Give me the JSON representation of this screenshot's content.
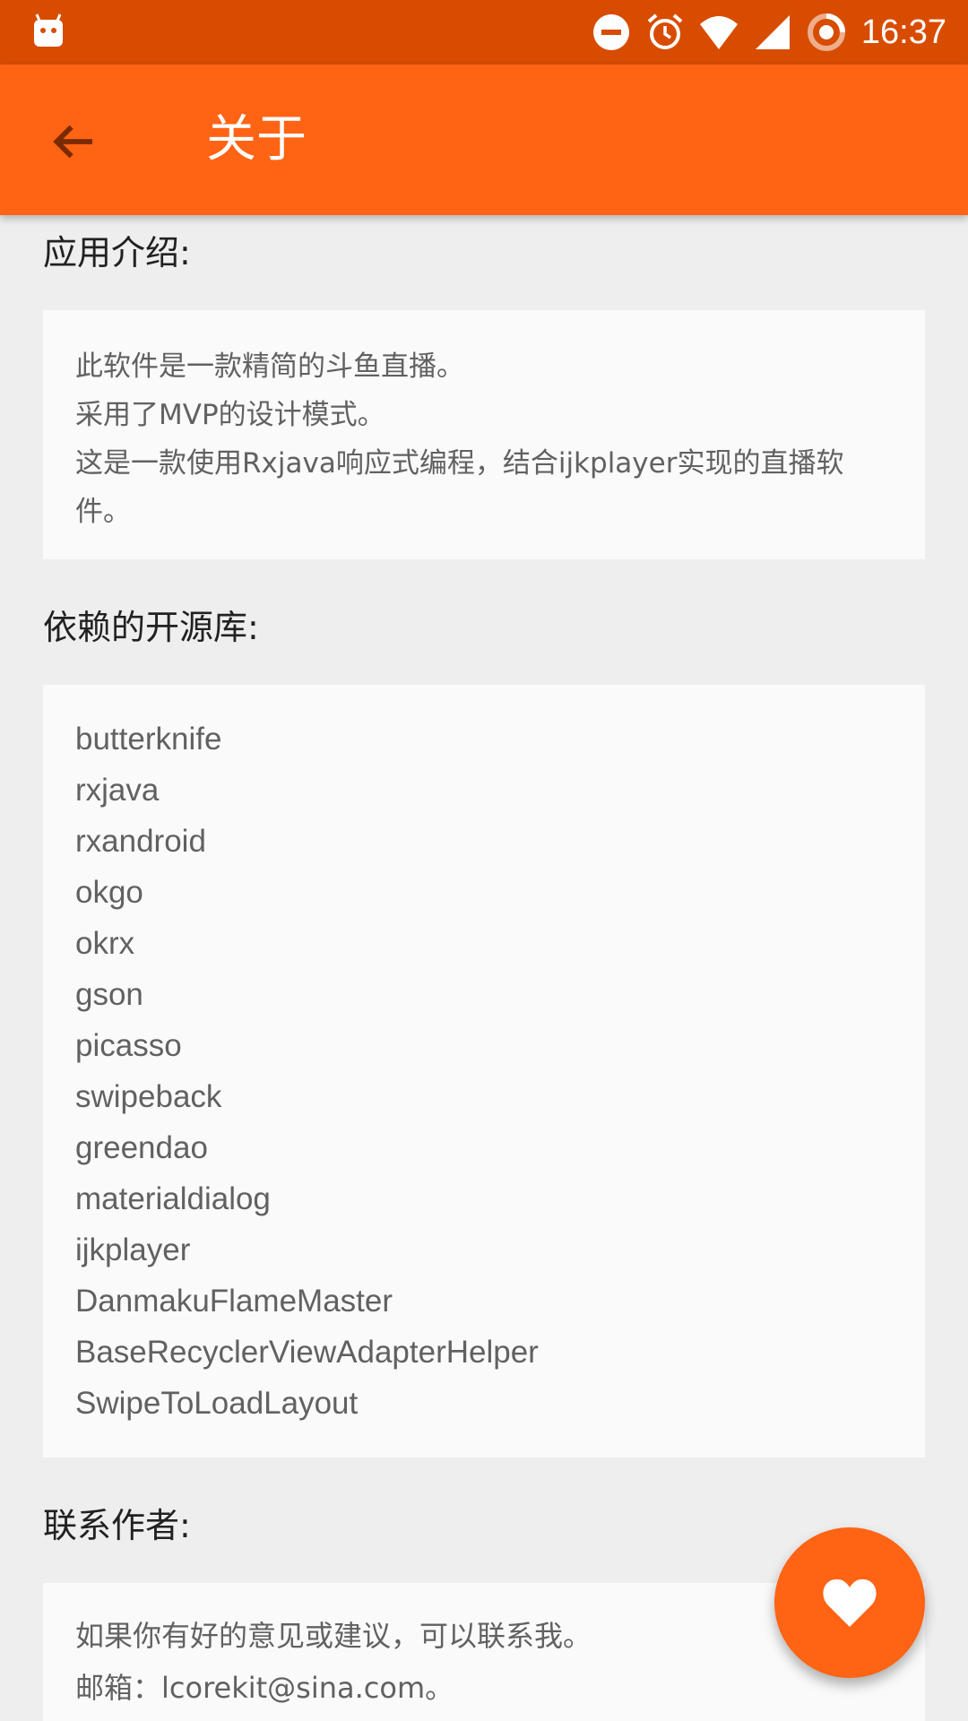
{
  "status_bar": {
    "time": "16:37",
    "icons": [
      "android-notification-icon",
      "do-not-disturb-icon",
      "alarm-icon",
      "wifi-icon",
      "cell-signal-icon",
      "battery-saver-icon"
    ]
  },
  "toolbar": {
    "back_icon": "arrow-back-icon",
    "title": "关于"
  },
  "sections": {
    "intro": {
      "title": "应用介绍:",
      "lines": [
        "此软件是一款精简的斗鱼直播。",
        "采用了MVP的设计模式。",
        "这是一款使用Rxjava响应式编程，结合ijkplayer实现的直播软",
        "件。"
      ]
    },
    "libraries": {
      "title": "依赖的开源库:",
      "items": [
        "butterknife",
        "rxjava",
        "rxandroid",
        "okgo",
        "okrx",
        "gson",
        "picasso",
        "swipeback",
        "greendao",
        "materialdialog",
        "ijkplayer",
        "DanmakuFlameMaster",
        "BaseRecyclerViewAdapterHelper",
        "SwipeToLoadLayout"
      ]
    },
    "contact": {
      "title": "联系作者:",
      "lines": [
        "如果你有好的意见或建议，可以联系我。",
        "邮箱：lcorekit@sina.com。"
      ]
    }
  },
  "fab": {
    "icon": "heart-icon"
  },
  "colors": {
    "status_bar": "#d84c00",
    "toolbar": "#ff6314",
    "fab": "#ff6314",
    "background": "#eeeeee",
    "card": "#fafafa",
    "body_text": "#616161"
  }
}
